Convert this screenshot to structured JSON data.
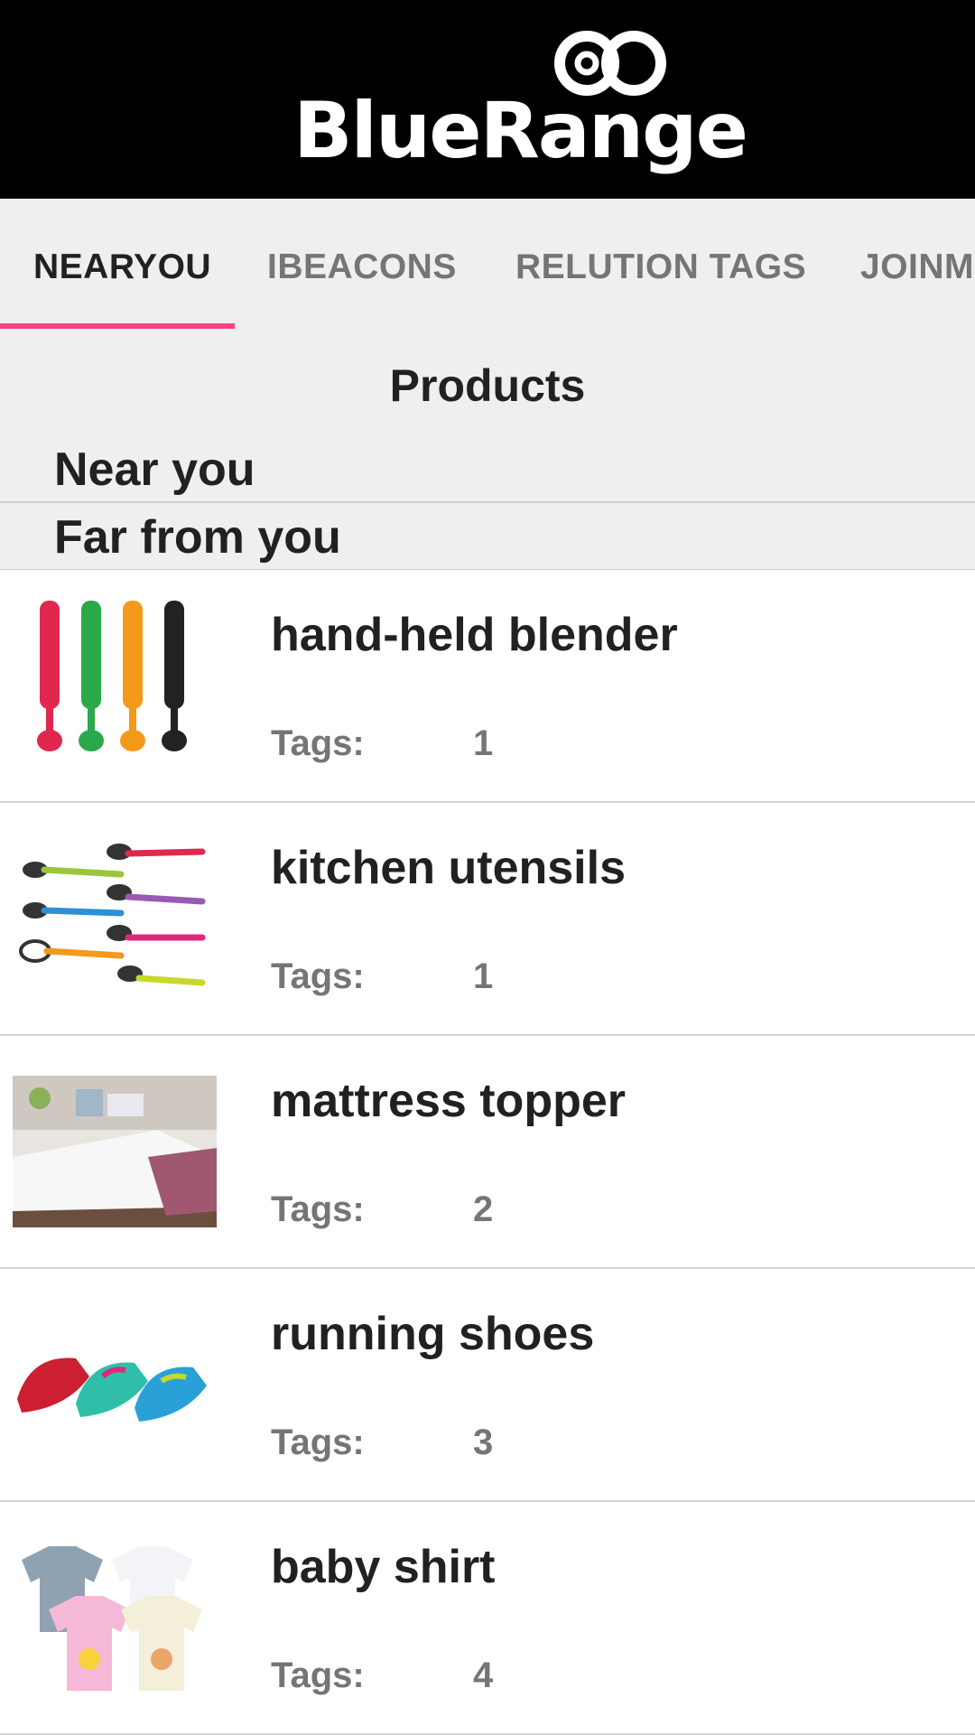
{
  "header": {
    "brand": "BlueRange",
    "background": "#000000"
  },
  "tabs": [
    {
      "label": "NEARYOU",
      "active": true
    },
    {
      "label": "IBEACONS",
      "active": false
    },
    {
      "label": "RELUTION TAGS",
      "active": false
    },
    {
      "label": "JOINM",
      "active": false
    }
  ],
  "accent_color": "#ff4081",
  "section": {
    "title": "Products",
    "near_label": "Near you",
    "far_label": "Far from you"
  },
  "products": [
    {
      "name": "hand-held blender",
      "tags_label": "Tags:",
      "tags": "1",
      "image": "blender-image"
    },
    {
      "name": "kitchen utensils",
      "tags_label": "Tags:",
      "tags": "1",
      "image": "utensils-image"
    },
    {
      "name": "mattress topper",
      "tags_label": "Tags:",
      "tags": "2",
      "image": "mattress-image"
    },
    {
      "name": "running shoes",
      "tags_label": "Tags:",
      "tags": "3",
      "image": "shoes-image"
    },
    {
      "name": "baby shirt",
      "tags_label": "Tags:",
      "tags": "4",
      "image": "shirt-image"
    }
  ]
}
